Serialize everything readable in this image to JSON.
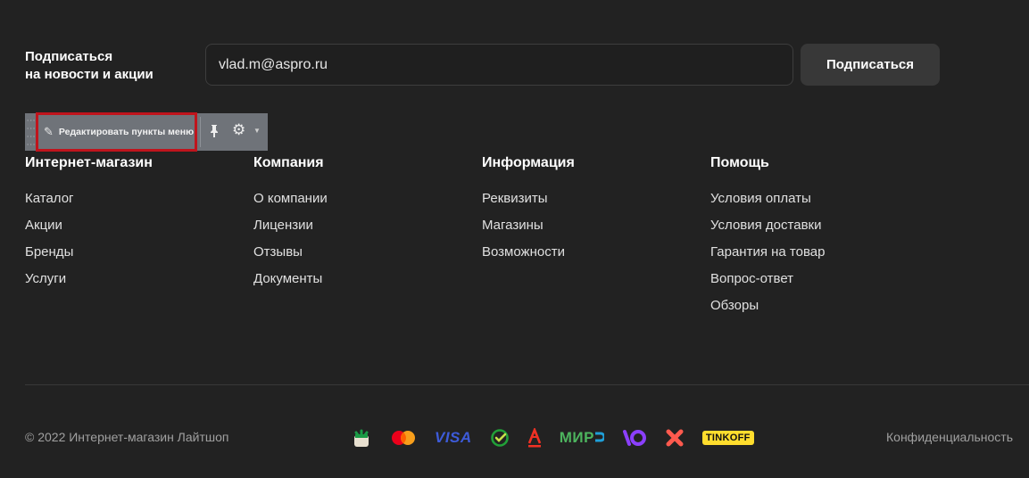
{
  "subscribe": {
    "title_line1": "Подписаться",
    "title_line2": "на новости и акции",
    "email_value": "vlad.m@aspro.ru",
    "button_label": "Подписаться"
  },
  "toolbar": {
    "edit_label": "Редактировать пункты меню",
    "icons": [
      "pencil-icon",
      "pin-icon",
      "gear-icon",
      "chevron-down-icon"
    ]
  },
  "menu": [
    {
      "title": "Интернет-магазин",
      "items": [
        "Каталог",
        "Акции",
        "Бренды",
        "Услуги"
      ]
    },
    {
      "title": "Компания",
      "items": [
        "О компании",
        "Лицензии",
        "Отзывы",
        "Документы"
      ]
    },
    {
      "title": "Информация",
      "items": [
        "Реквизиты",
        "Магазины",
        "Возможности"
      ]
    },
    {
      "title": "Помощь",
      "items": [
        "Условия оплаты",
        "Условия доставки",
        "Гарантия на товар",
        "Вопрос-ответ",
        "Обзоры"
      ]
    }
  ],
  "footer": {
    "copyright": "© 2022 Интернет-магазин Лайтшоп",
    "privacy": "Конфиденциальность",
    "payments": {
      "visa": "VISA",
      "mir": "МИР",
      "tinkoff": "TINKOFF"
    }
  },
  "colors": {
    "background": "#222222",
    "toolbar": "#6f7379",
    "highlight_border": "#c0141c",
    "button": "#383838"
  }
}
